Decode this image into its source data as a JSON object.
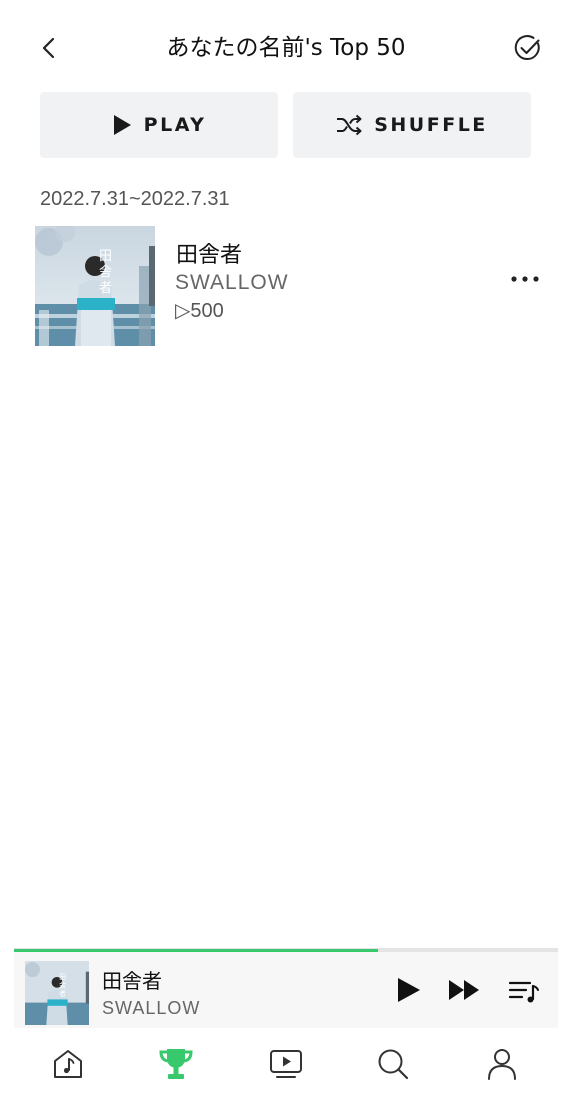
{
  "header": {
    "title": "あなたの名前's Top 50",
    "back_icon": "chevron-left-icon",
    "select_icon": "check-circle-icon"
  },
  "actions": {
    "play_label": "PLAY",
    "shuffle_label": "SHUFFLE"
  },
  "date_range": "2022.7.31~2022.7.31",
  "tracks": [
    {
      "title": "田舎者",
      "artist": "SWALLOW",
      "plays": "▷500",
      "more_icon": "more-horizontal-icon"
    }
  ],
  "mini_player": {
    "title": "田舎者",
    "artist": "SWALLOW",
    "progress_fraction": 0.67
  },
  "tabs": [
    {
      "name": "home",
      "icon": "music-home-icon",
      "active": false
    },
    {
      "name": "charts",
      "icon": "trophy-icon",
      "active": true
    },
    {
      "name": "video",
      "icon": "video-play-icon",
      "active": false
    },
    {
      "name": "search",
      "icon": "search-icon",
      "active": false
    },
    {
      "name": "profile",
      "icon": "user-icon",
      "active": false
    }
  ],
  "colors": {
    "accent": "#37c96b",
    "button_bg": "#f1f2f4",
    "text": "#111111",
    "muted": "#666666"
  }
}
